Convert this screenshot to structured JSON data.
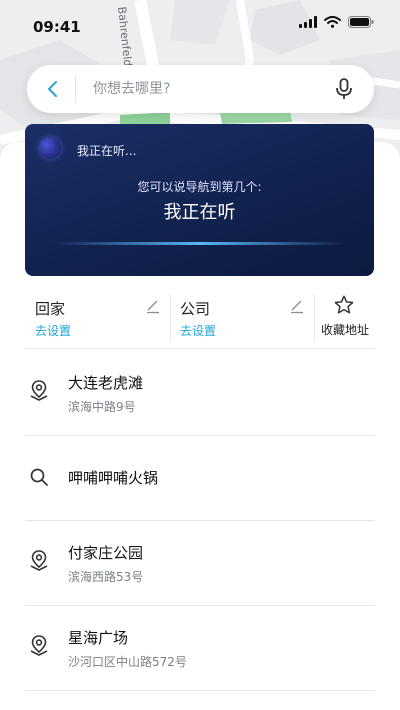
{
  "status_bar": {
    "time": "09:41"
  },
  "map": {
    "street_label": "Bahrenfeld"
  },
  "search": {
    "placeholder": "你想去哪里?"
  },
  "voice": {
    "status": "我正在听...",
    "hint": "您可以说导航到第几个:",
    "main": "我正在听"
  },
  "shortcuts": {
    "home": {
      "title": "回家",
      "action": "去设置"
    },
    "work": {
      "title": "公司",
      "action": "去设置"
    },
    "favorites": {
      "label": "收藏地址"
    }
  },
  "results": [
    {
      "icon": "location-pin-icon",
      "name": "大连老虎滩",
      "address": "滨海中路9号"
    },
    {
      "icon": "search-icon",
      "name": "呷哺呷哺火锅",
      "address": ""
    },
    {
      "icon": "location-pin-icon",
      "name": "付家庄公园",
      "address": "滨海西路53号"
    },
    {
      "icon": "location-pin-icon",
      "name": "星海广场",
      "address": "沙河口区中山路572号"
    }
  ],
  "colors": {
    "accent": "#1fa6d8",
    "voice_panel": "#14255a",
    "back_arrow": "#2b9fd8"
  }
}
